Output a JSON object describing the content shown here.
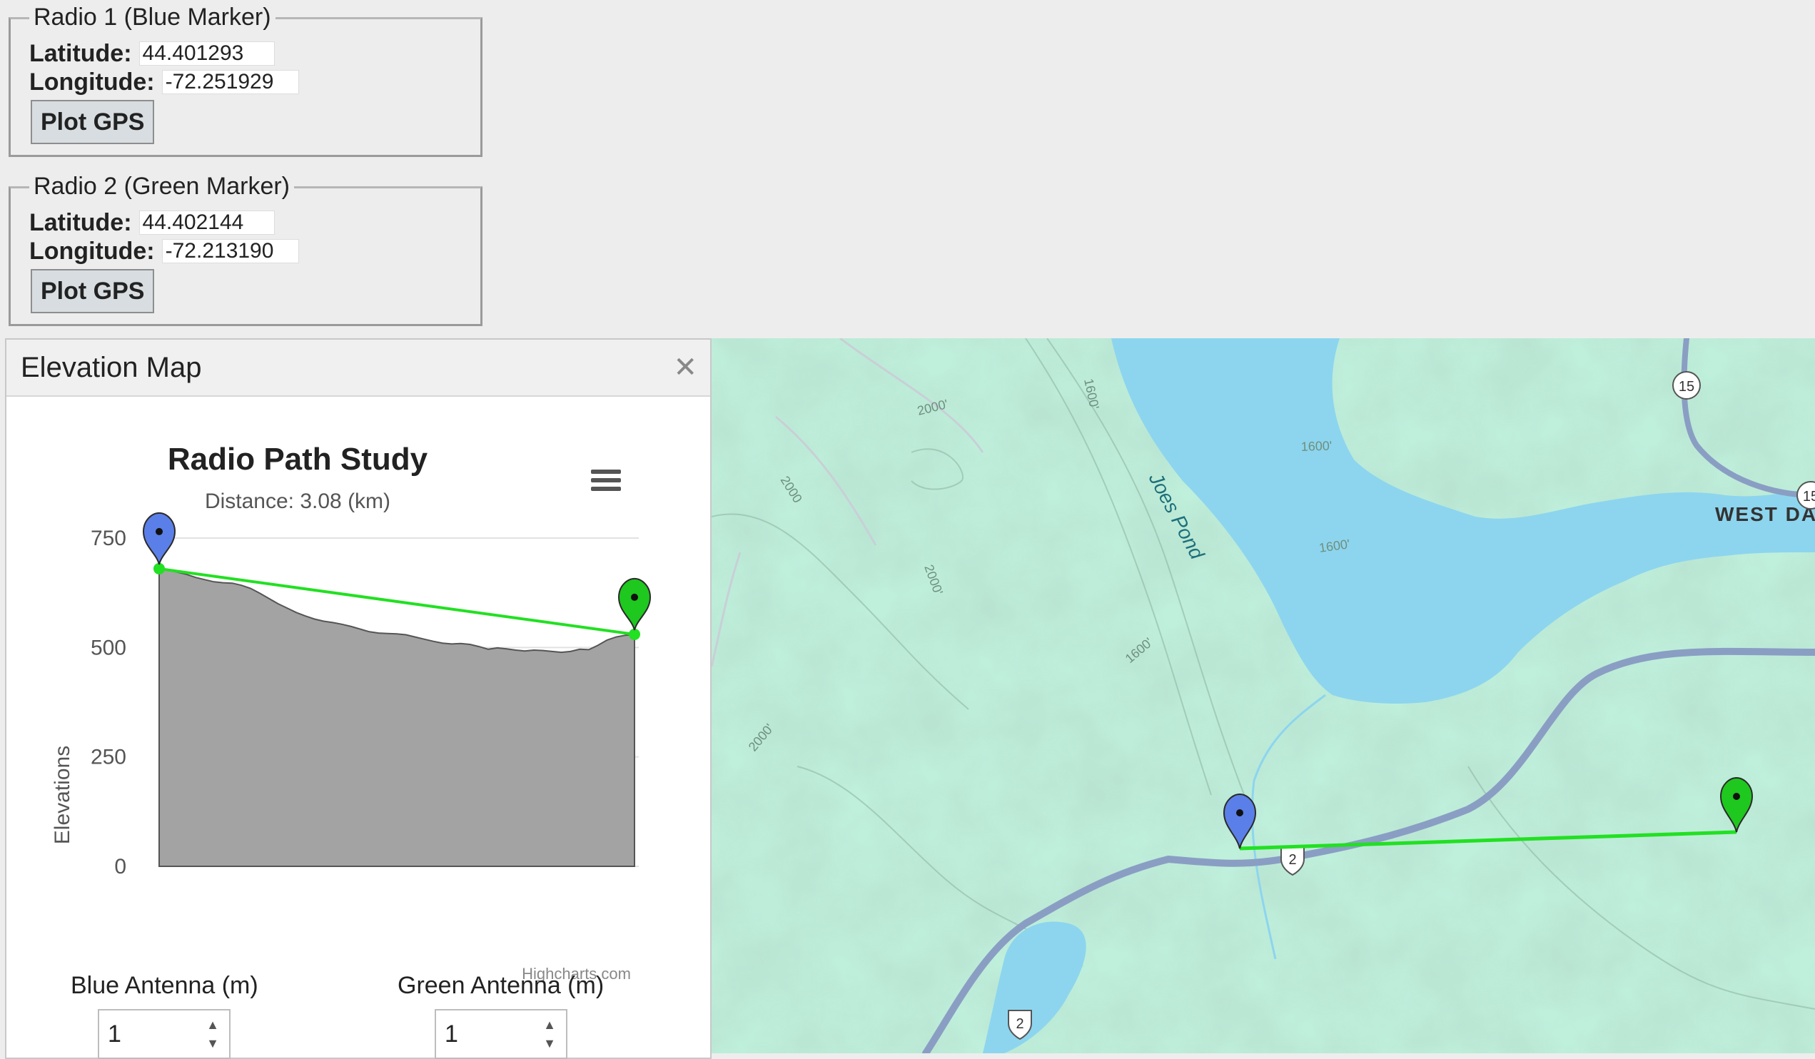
{
  "radio1": {
    "legend": "Radio 1 (Blue Marker)",
    "latitude_label": "Latitude:",
    "latitude": "44.401293",
    "longitude_label": "Longitude:",
    "longitude": "-72.251929",
    "button": "Plot GPS"
  },
  "radio2": {
    "legend": "Radio 2 (Green Marker)",
    "latitude_label": "Latitude:",
    "latitude": "44.402144",
    "longitude_label": "Longitude:",
    "longitude": "-72.213190",
    "button": "Plot GPS"
  },
  "dialog": {
    "title": "Elevation Map",
    "close_icon": "close-icon",
    "menu_icon": "hamburger-menu-icon",
    "credit": "Highcharts.com",
    "blue_antenna_label": "Blue Antenna (m)",
    "blue_antenna_value": "1",
    "green_antenna_label": "Green Antenna (m)",
    "green_antenna_value": "1"
  },
  "chart_data": {
    "type": "area",
    "title": "Radio Path Study",
    "subtitle": "Distance: 3.08 (km)",
    "ylabel": "Elevations",
    "xlabel": "",
    "ylim": [
      0,
      750
    ],
    "yticks": [
      0,
      250,
      500,
      750
    ],
    "grid": true,
    "series": [
      {
        "values": [
          680,
          677,
          672,
          667,
          660,
          655,
          650,
          648,
          647,
          642,
          635,
          624,
          612,
          600,
          590,
          580,
          572,
          565,
          560,
          557,
          553,
          548,
          542,
          536,
          533,
          532,
          531,
          529,
          524,
          519,
          514,
          510,
          508,
          509,
          507,
          502,
          496,
          499,
          497,
          494,
          492,
          494,
          493,
          491,
          489,
          491,
          496,
          495,
          505,
          517,
          524,
          528,
          530
        ]
      }
    ],
    "line_of_sight": {
      "start": 680,
      "end": 530,
      "color": "#22e022"
    },
    "marker_colors": {
      "blue": "#5b7fe8",
      "green": "#1ec81e"
    },
    "fill_color": "#a3a3a3"
  },
  "map": {
    "lake_label": "Joes Pond",
    "town_label": "WEST DANVILLE",
    "route_15_top": "15",
    "route_15_right": "15",
    "route_2_mid": "2",
    "route_2_bottom": "2",
    "contours": [
      "1600'",
      "2000'",
      "2000",
      "2000'",
      "1600'",
      "1600'",
      "1600'",
      "2000'"
    ],
    "colors": {
      "land": "#bff0dc",
      "water": "#8dd5ee",
      "road": "#8a9ec4",
      "path": "#22e022"
    }
  }
}
